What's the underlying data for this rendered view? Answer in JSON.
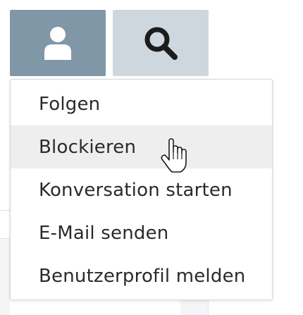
{
  "buttons": {
    "user_icon": "user-icon",
    "search_icon": "search-icon"
  },
  "menu": {
    "items": [
      {
        "label": "Folgen"
      },
      {
        "label": "Blockieren"
      },
      {
        "label": "Konversation starten"
      },
      {
        "label": "E-Mail senden"
      },
      {
        "label": "Benutzerprofil melden"
      }
    ],
    "hovered_index": 1
  },
  "colors": {
    "user_button_bg": "#7f97a6",
    "search_button_bg": "#cfd7de",
    "hover_bg": "#eeeeee",
    "text": "#2a2a2a"
  }
}
